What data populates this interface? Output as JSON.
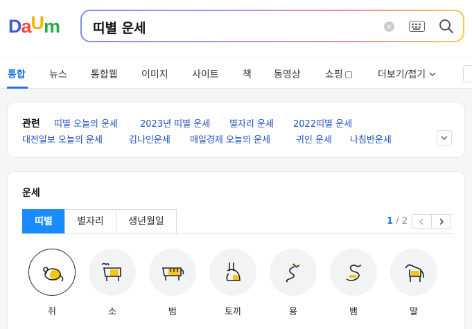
{
  "logo": {
    "letters": [
      "D",
      "a",
      "U",
      "m"
    ],
    "colors": [
      "#3c5bd8",
      "#f04a3e",
      "#f7b500",
      "#2aaa4a"
    ]
  },
  "search": {
    "query": "띠별 운세",
    "icons": [
      "clear-icon",
      "keyboard-icon",
      "search-icon"
    ]
  },
  "tabs": [
    {
      "label": "통합",
      "active": true
    },
    {
      "label": "뉴스"
    },
    {
      "label": "통합웹"
    },
    {
      "label": "이미지"
    },
    {
      "label": "사이트"
    },
    {
      "label": "책"
    },
    {
      "label": "동영상"
    },
    {
      "label": "쇼핑"
    },
    {
      "label": "더보기/접기"
    }
  ],
  "related": {
    "title": "관련",
    "links": [
      "띠별 오늘의 운세",
      "2023년 띠별 운세",
      "별자리 운세",
      "2022띠별 운세",
      "대전일보 오늘의 운세",
      "김나인운세",
      "매일경제 오늘의 운세",
      "귀인 운세",
      "나침반운세"
    ]
  },
  "fortune": {
    "title": "운세",
    "segments": [
      {
        "label": "띠별",
        "active": true
      },
      {
        "label": "별자리"
      },
      {
        "label": "생년월일"
      }
    ],
    "pager": {
      "current": "1",
      "total": "2"
    },
    "animals": [
      {
        "label": "쥐",
        "icon": "rat-icon",
        "selected": true
      },
      {
        "label": "소",
        "icon": "ox-icon"
      },
      {
        "label": "범",
        "icon": "tiger-icon"
      },
      {
        "label": "토끼",
        "icon": "rabbit-icon"
      },
      {
        "label": "용",
        "icon": "dragon-icon"
      },
      {
        "label": "뱀",
        "icon": "snake-icon"
      },
      {
        "label": "말",
        "icon": "horse-icon"
      }
    ]
  },
  "colors": {
    "accent": "#1a8cff",
    "link": "#1a4fbd",
    "icon_yellow": "#f5c518"
  }
}
